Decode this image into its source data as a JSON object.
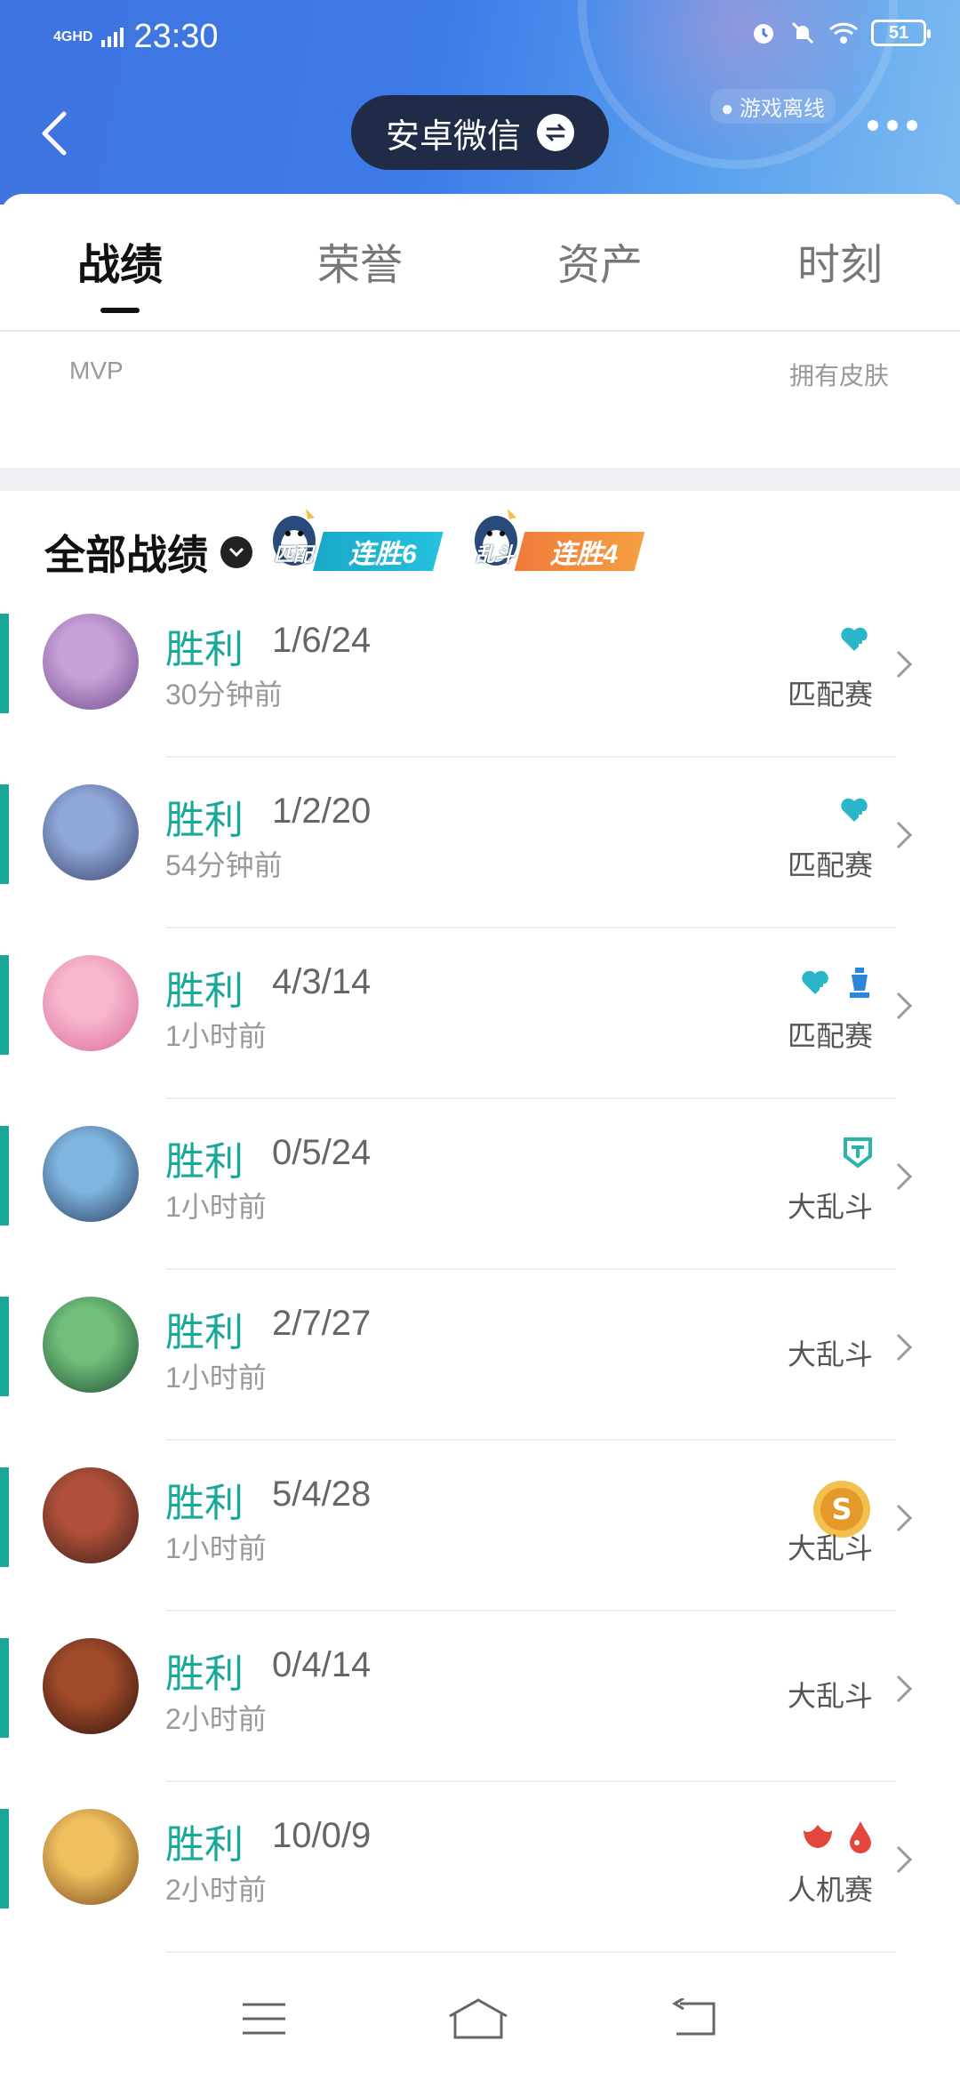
{
  "status_bar": {
    "network": "4GHD",
    "time": "23:30",
    "battery": "51"
  },
  "header": {
    "account_label": "安卓微信",
    "game_status": "游戏离线"
  },
  "tabs": [
    {
      "label": "战绩",
      "active": true
    },
    {
      "label": "荣誉",
      "active": false
    },
    {
      "label": "资产",
      "active": false
    },
    {
      "label": "时刻",
      "active": false
    }
  ],
  "stats": {
    "left_label": "MVP",
    "right_label": "拥有皮肤"
  },
  "section": {
    "title": "全部战绩",
    "streaks": [
      {
        "mode": "匹配",
        "text": "连胜6",
        "color": "#1fb6d6"
      },
      {
        "mode": "乱斗",
        "text": "连胜4",
        "color": "#f28a3c"
      }
    ]
  },
  "records": [
    {
      "result": "胜利",
      "kda": "1/6/24",
      "time": "30分钟前",
      "mode": "匹配赛",
      "badges": [
        "heart-plus-icon"
      ],
      "avatar_colors": [
        "#c8a0d8",
        "#6a4b8a"
      ]
    },
    {
      "result": "胜利",
      "kda": "1/2/20",
      "time": "54分钟前",
      "mode": "匹配赛",
      "badges": [
        "heart-plus-icon"
      ],
      "avatar_colors": [
        "#8fa8d8",
        "#3a3f6a"
      ]
    },
    {
      "result": "胜利",
      "kda": "4/3/14",
      "time": "1小时前",
      "mode": "匹配赛",
      "badges": [
        "heart-plus-icon",
        "chess-piece-icon"
      ],
      "avatar_colors": [
        "#f6b6cc",
        "#d86a9a"
      ]
    },
    {
      "result": "胜利",
      "kda": "0/5/24",
      "time": "1小时前",
      "mode": "大乱斗",
      "badges": [
        "shield-icon"
      ],
      "avatar_colors": [
        "#7fb6e0",
        "#2a3b5e"
      ]
    },
    {
      "result": "胜利",
      "kda": "2/7/27",
      "time": "1小时前",
      "mode": "大乱斗",
      "badges": [],
      "avatar_colors": [
        "#6fbf7a",
        "#1f4a33"
      ]
    },
    {
      "result": "胜利",
      "kda": "5/4/28",
      "time": "1小时前",
      "mode": "大乱斗",
      "badges": [
        "gold-coin-icon"
      ],
      "avatar_colors": [
        "#b0503a",
        "#3a1f1a"
      ]
    },
    {
      "result": "胜利",
      "kda": "0/4/14",
      "time": "2小时前",
      "mode": "大乱斗",
      "badges": [],
      "avatar_colors": [
        "#a04a2a",
        "#2e140c"
      ]
    },
    {
      "result": "胜利",
      "kda": "10/0/9",
      "time": "2小时前",
      "mode": "人机赛",
      "badges": [
        "flame-icon",
        "blood-drop-icon"
      ],
      "avatar_colors": [
        "#f0c060",
        "#7a4a1a"
      ]
    }
  ],
  "colors": {
    "accent": "#18a89a",
    "header_blue": "#3f73e0"
  }
}
